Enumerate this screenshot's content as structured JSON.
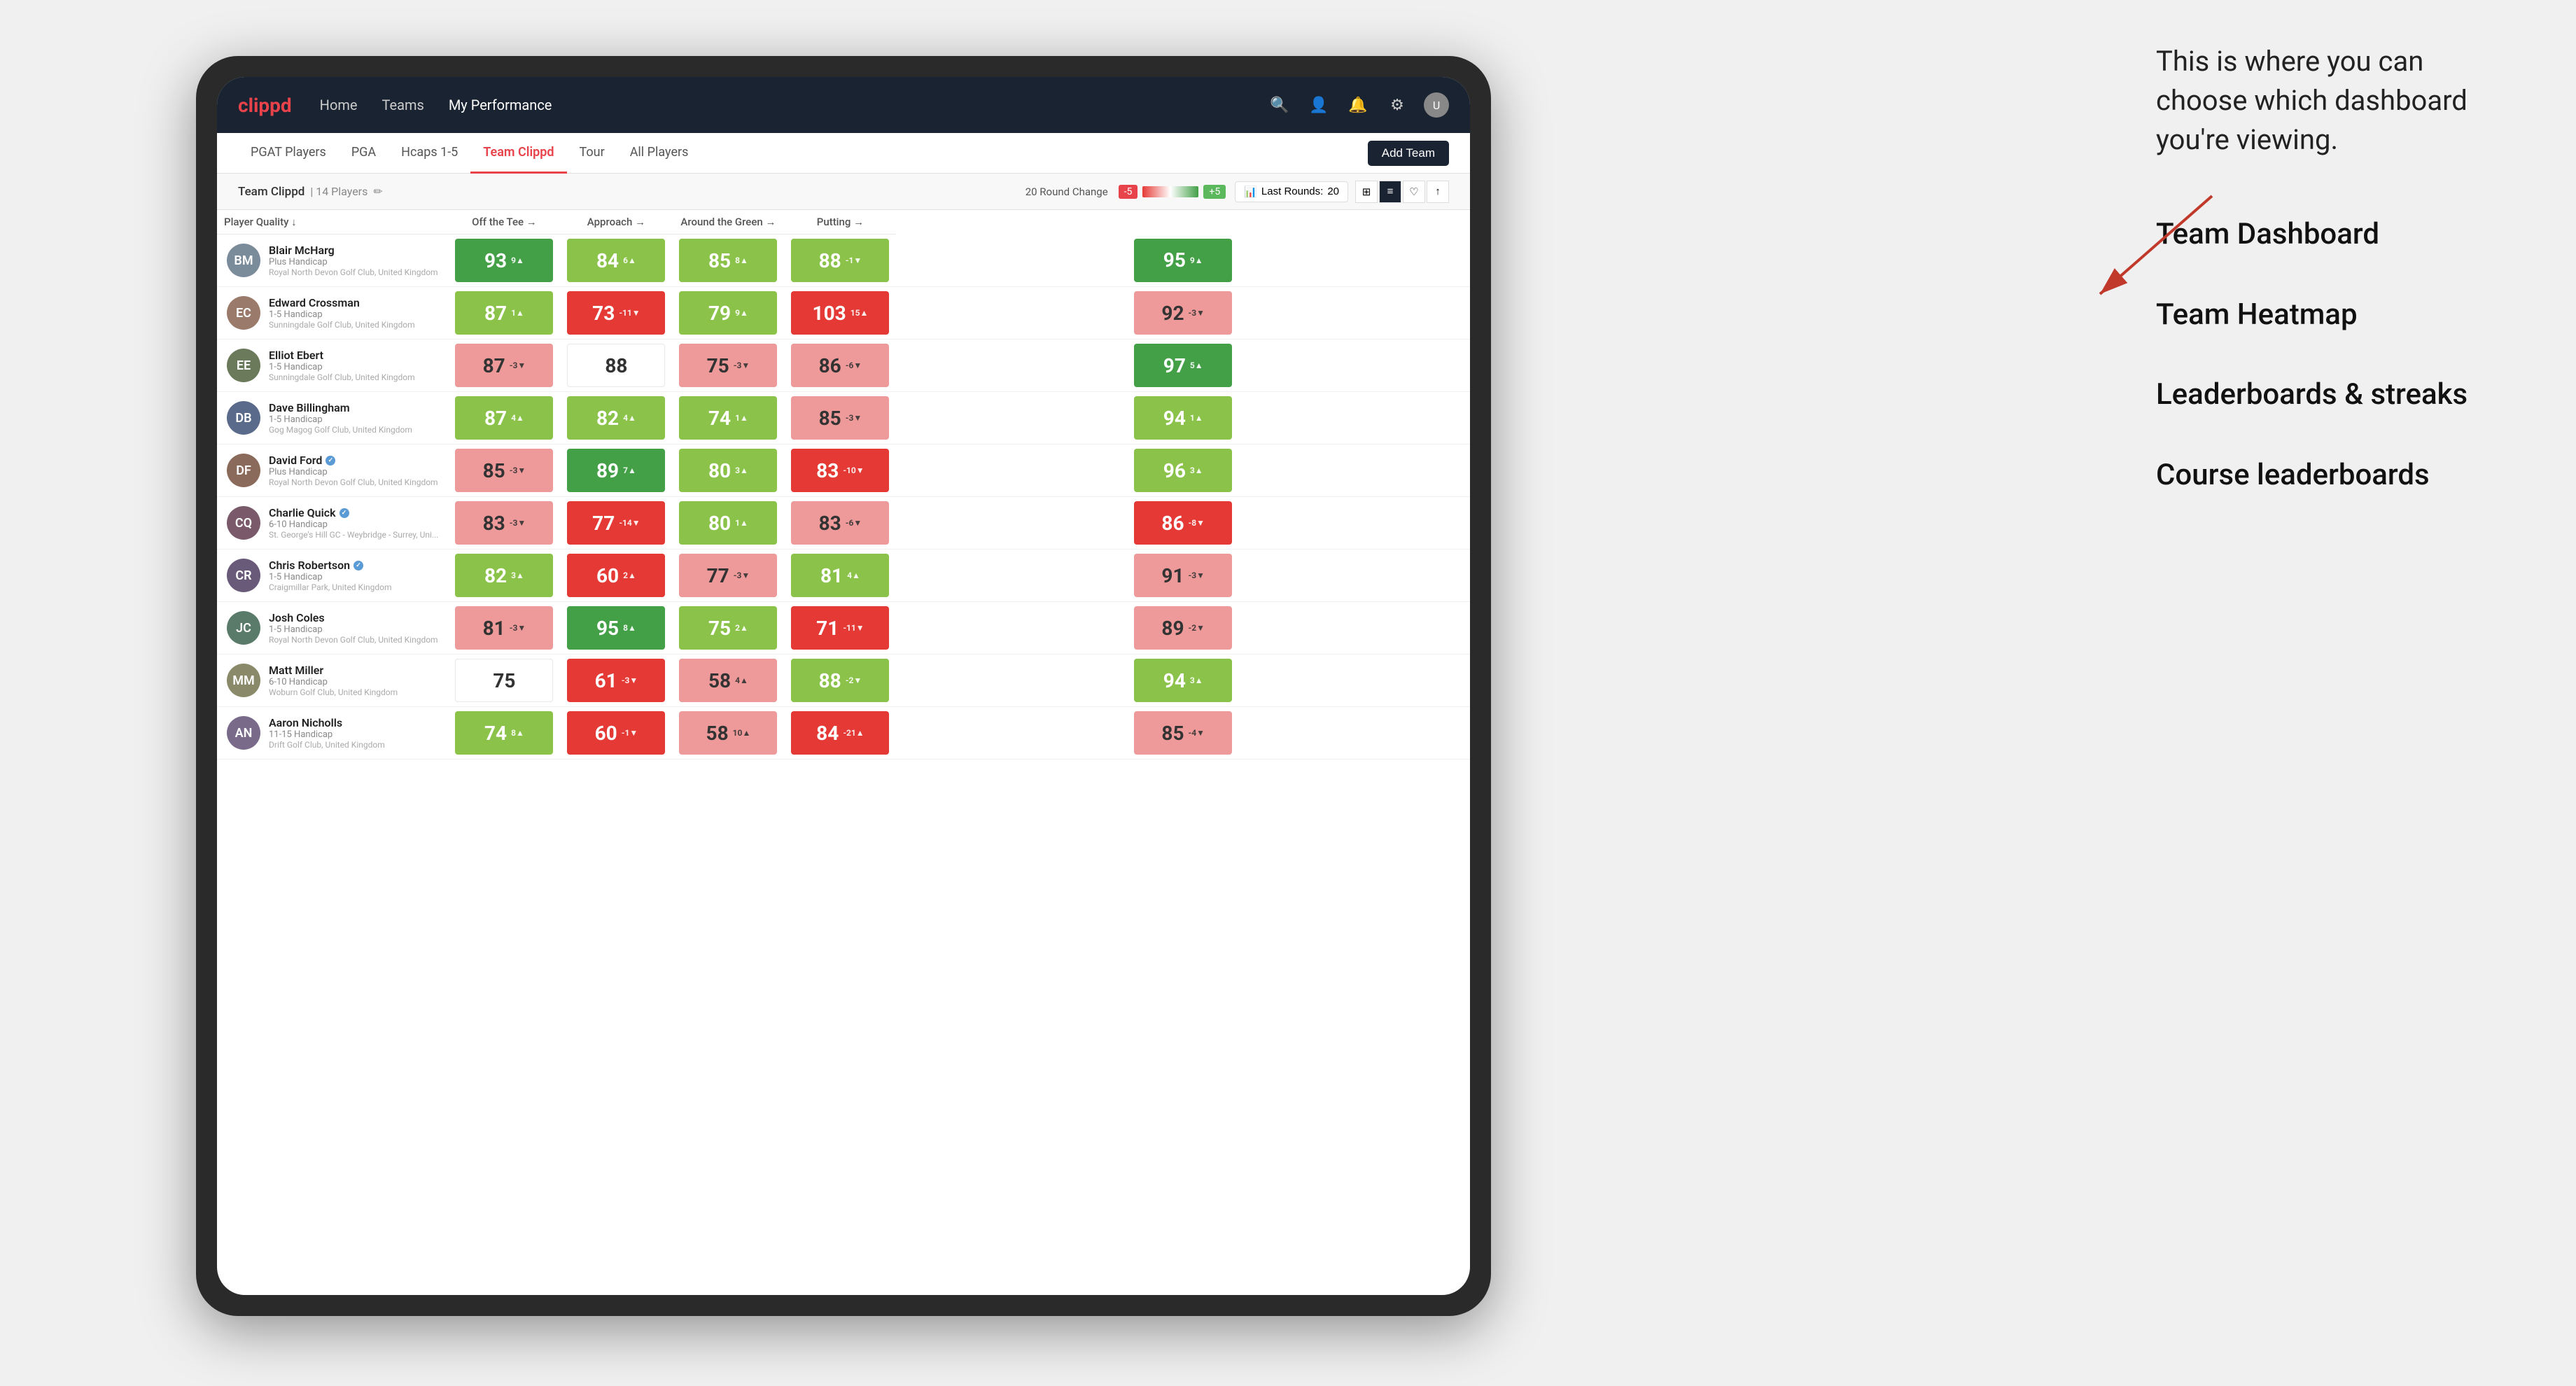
{
  "annotation": {
    "intro": "This is where you can choose which dashboard you're viewing.",
    "items": [
      "Team Dashboard",
      "Team Heatmap",
      "Leaderboards & streaks",
      "Course leaderboards"
    ]
  },
  "nav": {
    "logo": "clippd",
    "links": [
      "Home",
      "Teams",
      "My Performance"
    ],
    "active_link": "My Performance"
  },
  "sub_nav": {
    "links": [
      "PGAT Players",
      "PGA",
      "Hcaps 1-5",
      "Team Clippd",
      "Tour",
      "All Players"
    ],
    "active": "Team Clippd",
    "add_button": "Add Team"
  },
  "team_bar": {
    "name": "Team Clippd",
    "count": "14 Players",
    "round_change_label": "20 Round Change",
    "badge_neg": "-5",
    "badge_pos": "+5",
    "last_rounds_label": "Last Rounds:",
    "last_rounds_value": "20"
  },
  "table": {
    "headers": [
      "Player Quality ↓",
      "Off the Tee →",
      "Approach →",
      "Around the Green →",
      "Putting →"
    ],
    "rows": [
      {
        "name": "Blair McHarg",
        "handicap": "Plus Handicap",
        "club": "Royal North Devon Golf Club, United Kingdom",
        "avatar_color": "#7a8b9a",
        "initials": "BM",
        "scores": [
          {
            "value": 93,
            "change": "9▲",
            "color": "green"
          },
          {
            "value": 84,
            "change": "6▲",
            "color": "green-light"
          },
          {
            "value": 85,
            "change": "8▲",
            "color": "green-light"
          },
          {
            "value": 88,
            "change": "-1▼",
            "color": "green-light"
          },
          {
            "value": 95,
            "change": "9▲",
            "color": "green"
          }
        ]
      },
      {
        "name": "Edward Crossman",
        "handicap": "1-5 Handicap",
        "club": "Sunningdale Golf Club, United Kingdom",
        "avatar_color": "#9a7a6a",
        "initials": "EC",
        "scores": [
          {
            "value": 87,
            "change": "1▲",
            "color": "green-light"
          },
          {
            "value": 73,
            "change": "-11▼",
            "color": "red"
          },
          {
            "value": 79,
            "change": "9▲",
            "color": "green-light"
          },
          {
            "value": 103,
            "change": "15▲",
            "color": "red"
          },
          {
            "value": 92,
            "change": "-3▼",
            "color": "red-light"
          }
        ]
      },
      {
        "name": "Elliot Ebert",
        "handicap": "1-5 Handicap",
        "club": "Sunningdale Golf Club, United Kingdom",
        "avatar_color": "#6a7a5a",
        "initials": "EE",
        "scores": [
          {
            "value": 87,
            "change": "-3▼",
            "color": "red-light"
          },
          {
            "value": 88,
            "change": "",
            "color": "white"
          },
          {
            "value": 75,
            "change": "-3▼",
            "color": "red-light"
          },
          {
            "value": 86,
            "change": "-6▼",
            "color": "red-light"
          },
          {
            "value": 97,
            "change": "5▲",
            "color": "green"
          }
        ]
      },
      {
        "name": "Dave Billingham",
        "handicap": "1-5 Handicap",
        "club": "Gog Magog Golf Club, United Kingdom",
        "avatar_color": "#5a6a8a",
        "initials": "DB",
        "scores": [
          {
            "value": 87,
            "change": "4▲",
            "color": "green-light"
          },
          {
            "value": 82,
            "change": "4▲",
            "color": "green-light"
          },
          {
            "value": 74,
            "change": "1▲",
            "color": "green-light"
          },
          {
            "value": 85,
            "change": "-3▼",
            "color": "red-light"
          },
          {
            "value": 94,
            "change": "1▲",
            "color": "green-light"
          }
        ]
      },
      {
        "name": "David Ford",
        "handicap": "Plus Handicap",
        "club": "Royal North Devon Golf Club, United Kingdom",
        "avatar_color": "#8a6a5a",
        "initials": "DF",
        "verified": true,
        "scores": [
          {
            "value": 85,
            "change": "-3▼",
            "color": "red-light"
          },
          {
            "value": 89,
            "change": "7▲",
            "color": "green"
          },
          {
            "value": 80,
            "change": "3▲",
            "color": "green-light"
          },
          {
            "value": 83,
            "change": "-10▼",
            "color": "red"
          },
          {
            "value": 96,
            "change": "3▲",
            "color": "green-light"
          }
        ]
      },
      {
        "name": "Charlie Quick",
        "handicap": "6-10 Handicap",
        "club": "St. George's Hill GC - Weybridge - Surrey, Uni...",
        "avatar_color": "#7a5a6a",
        "initials": "CQ",
        "verified": true,
        "scores": [
          {
            "value": 83,
            "change": "-3▼",
            "color": "red-light"
          },
          {
            "value": 77,
            "change": "-14▼",
            "color": "red"
          },
          {
            "value": 80,
            "change": "1▲",
            "color": "green-light"
          },
          {
            "value": 83,
            "change": "-6▼",
            "color": "red-light"
          },
          {
            "value": 86,
            "change": "-8▼",
            "color": "red"
          }
        ]
      },
      {
        "name": "Chris Robertson",
        "handicap": "1-5 Handicap",
        "club": "Craigmillar Park, United Kingdom",
        "avatar_color": "#6a5a7a",
        "initials": "CR",
        "verified": true,
        "scores": [
          {
            "value": 82,
            "change": "3▲",
            "color": "green-light"
          },
          {
            "value": 60,
            "change": "2▲",
            "color": "red"
          },
          {
            "value": 77,
            "change": "-3▼",
            "color": "red-light"
          },
          {
            "value": 81,
            "change": "4▲",
            "color": "green-light"
          },
          {
            "value": 91,
            "change": "-3▼",
            "color": "red-light"
          }
        ]
      },
      {
        "name": "Josh Coles",
        "handicap": "1-5 Handicap",
        "club": "Royal North Devon Golf Club, United Kingdom",
        "avatar_color": "#5a7a6a",
        "initials": "JC",
        "scores": [
          {
            "value": 81,
            "change": "-3▼",
            "color": "red-light"
          },
          {
            "value": 95,
            "change": "8▲",
            "color": "green"
          },
          {
            "value": 75,
            "change": "2▲",
            "color": "green-light"
          },
          {
            "value": 71,
            "change": "-11▼",
            "color": "red"
          },
          {
            "value": 89,
            "change": "-2▼",
            "color": "red-light"
          }
        ]
      },
      {
        "name": "Matt Miller",
        "handicap": "6-10 Handicap",
        "club": "Woburn Golf Club, United Kingdom",
        "avatar_color": "#8a8a6a",
        "initials": "MM",
        "scores": [
          {
            "value": 75,
            "change": "",
            "color": "white"
          },
          {
            "value": 61,
            "change": "-3▼",
            "color": "red"
          },
          {
            "value": 58,
            "change": "4▲",
            "color": "red-light"
          },
          {
            "value": 88,
            "change": "-2▼",
            "color": "green-light"
          },
          {
            "value": 94,
            "change": "3▲",
            "color": "green-light"
          }
        ]
      },
      {
        "name": "Aaron Nicholls",
        "handicap": "11-15 Handicap",
        "club": "Drift Golf Club, United Kingdom",
        "avatar_color": "#7a6a8a",
        "initials": "AN",
        "scores": [
          {
            "value": 74,
            "change": "8▲",
            "color": "green-light"
          },
          {
            "value": 60,
            "change": "-1▼",
            "color": "red"
          },
          {
            "value": 58,
            "change": "10▲",
            "color": "red-light"
          },
          {
            "value": 84,
            "change": "-21▲",
            "color": "red"
          },
          {
            "value": 85,
            "change": "-4▼",
            "color": "red-light"
          }
        ]
      }
    ]
  },
  "colors": {
    "green": "#43a047",
    "green_light": "#8bc34a",
    "red": "#e53935",
    "red_light": "#ef9a9a",
    "white": "#ffffff",
    "nav_bg": "#1a2332",
    "accent": "#e8424a"
  }
}
